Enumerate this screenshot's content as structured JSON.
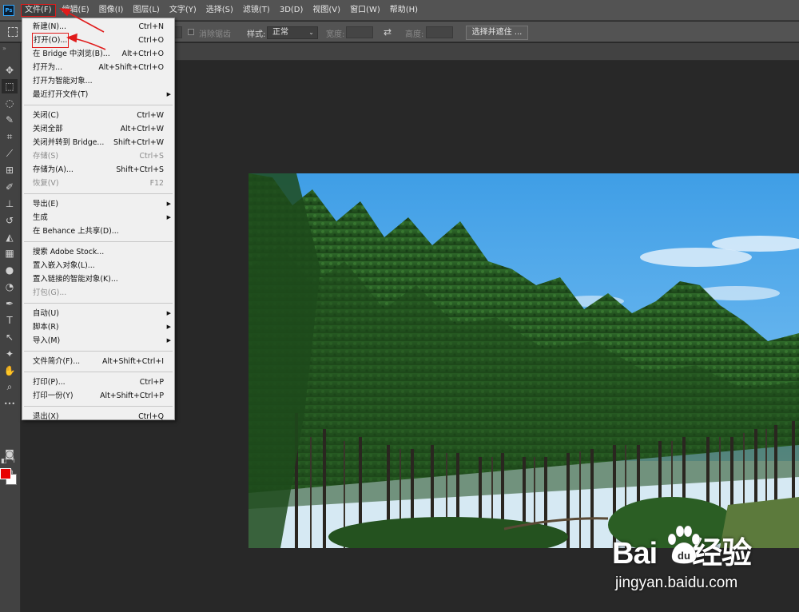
{
  "app": {
    "logo_text": "Ps"
  },
  "menubar": {
    "items": [
      "文件(F)",
      "编辑(E)",
      "图像(I)",
      "图层(L)",
      "文字(Y)",
      "选择(S)",
      "滤镜(T)",
      "3D(D)",
      "视图(V)",
      "窗口(W)",
      "帮助(H)"
    ],
    "active_index": 0
  },
  "options_bar": {
    "antialias_label": "消除锯齿",
    "style_label": "样式:",
    "style_value": "正常",
    "width_label": "宽度:",
    "height_label": "高度:",
    "select_and_mask": "选择并遮住 ..."
  },
  "file_menu": {
    "groups": [
      [
        {
          "label": "新建(N)...",
          "shortcut": "Ctrl+N"
        },
        {
          "label": "打开(O)...",
          "shortcut": "Ctrl+O",
          "highlight": true
        },
        {
          "label": "在 Bridge 中浏览(B)...",
          "shortcut": "Alt+Ctrl+O"
        },
        {
          "label": "打开为...",
          "shortcut": "Alt+Shift+Ctrl+O"
        },
        {
          "label": "打开为智能对象..."
        },
        {
          "label": "最近打开文件(T)",
          "submenu": true
        }
      ],
      [
        {
          "label": "关闭(C)",
          "shortcut": "Ctrl+W"
        },
        {
          "label": "关闭全部",
          "shortcut": "Alt+Ctrl+W"
        },
        {
          "label": "关闭并转到 Bridge...",
          "shortcut": "Shift+Ctrl+W"
        },
        {
          "label": "存储(S)",
          "shortcut": "Ctrl+S",
          "disabled": true
        },
        {
          "label": "存储为(A)...",
          "shortcut": "Shift+Ctrl+S"
        },
        {
          "label": "恢复(V)",
          "shortcut": "F12",
          "disabled": true
        }
      ],
      [
        {
          "label": "导出(E)",
          "submenu": true
        },
        {
          "label": "生成",
          "submenu": true
        },
        {
          "label": "在 Behance 上共享(D)..."
        }
      ],
      [
        {
          "label": "搜索 Adobe Stock..."
        },
        {
          "label": "置入嵌入对象(L)..."
        },
        {
          "label": "置入链接的智能对象(K)..."
        },
        {
          "label": "打包(G)...",
          "disabled": true
        }
      ],
      [
        {
          "label": "自动(U)",
          "submenu": true
        },
        {
          "label": "脚本(R)",
          "submenu": true
        },
        {
          "label": "导入(M)",
          "submenu": true
        }
      ],
      [
        {
          "label": "文件简介(F)...",
          "shortcut": "Alt+Shift+Ctrl+I"
        }
      ],
      [
        {
          "label": "打印(P)...",
          "shortcut": "Ctrl+P"
        },
        {
          "label": "打印一份(Y)",
          "shortcut": "Alt+Shift+Ctrl+P"
        }
      ],
      [
        {
          "label": "退出(X)",
          "shortcut": "Ctrl+Q"
        }
      ]
    ]
  },
  "toolbar": {
    "tools": [
      {
        "name": "move-tool",
        "glyph": "✥"
      },
      {
        "name": "rectangular-marquee-tool",
        "glyph": "⬚",
        "selected": true
      },
      {
        "name": "lasso-tool",
        "glyph": "◌"
      },
      {
        "name": "quick-selection-tool",
        "glyph": "✎"
      },
      {
        "name": "crop-tool",
        "glyph": "⌗"
      },
      {
        "name": "eyedropper-tool",
        "glyph": "⟋"
      },
      {
        "name": "spot-healing-tool",
        "glyph": "⊞"
      },
      {
        "name": "brush-tool",
        "glyph": "✐"
      },
      {
        "name": "clone-stamp-tool",
        "glyph": "⊥"
      },
      {
        "name": "history-brush-tool",
        "glyph": "↺"
      },
      {
        "name": "eraser-tool",
        "glyph": "◭"
      },
      {
        "name": "gradient-tool",
        "glyph": "▦"
      },
      {
        "name": "blur-tool",
        "glyph": "●"
      },
      {
        "name": "dodge-tool",
        "glyph": "◔"
      },
      {
        "name": "pen-tool",
        "glyph": "✒"
      },
      {
        "name": "type-tool",
        "glyph": "T"
      },
      {
        "name": "path-selection-tool",
        "glyph": "↖"
      },
      {
        "name": "custom-shape-tool",
        "glyph": "✦"
      },
      {
        "name": "hand-tool",
        "glyph": "✋"
      },
      {
        "name": "zoom-tool",
        "glyph": "⌕"
      },
      {
        "name": "more-tools",
        "glyph": "•••"
      }
    ],
    "extra": [
      {
        "name": "quick-mask-icon",
        "glyph": "◙"
      },
      {
        "name": "screen-mode-icon",
        "glyph": "⧉"
      }
    ],
    "foreground_color": "#e80000",
    "background_color": "#ffffff"
  },
  "watermark": {
    "logo_left": "Bai",
    "logo_right": "经验",
    "url": "jingyan.baidu.com"
  }
}
